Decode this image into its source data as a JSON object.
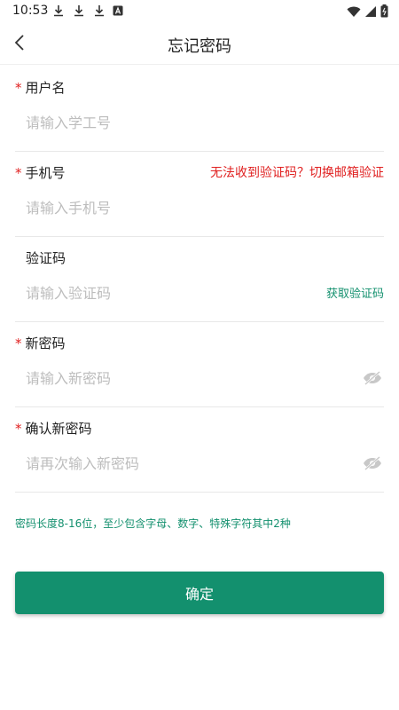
{
  "status_bar": {
    "time": "10:53",
    "icons": [
      "download-icon",
      "download-icon",
      "download-icon",
      "a-notification-icon",
      "wifi-icon",
      "signal-icon",
      "battery-icon"
    ]
  },
  "header": {
    "title": "忘记密码",
    "back_icon": "chevron-left-icon"
  },
  "form": {
    "username": {
      "label": "用户名",
      "placeholder": "请输入学工号"
    },
    "phone": {
      "label": "手机号",
      "placeholder": "请输入手机号",
      "switch_link": "无法收到验证码？切换邮箱验证"
    },
    "code": {
      "label": "验证码",
      "placeholder": "请输入验证码",
      "get_code": "获取验证码"
    },
    "new_password": {
      "label": "新密码",
      "placeholder": "请输入新密码"
    },
    "confirm_password": {
      "label": "确认新密码",
      "placeholder": "请再次输入新密码"
    }
  },
  "required_mark": "*",
  "hint": "密码长度8-16位，至少包含字母、数字、特殊字符其中2种",
  "confirm_button": "确定",
  "colors": {
    "accent": "#13906e",
    "required": "#e02020",
    "placeholder": "#bdbdbd"
  }
}
